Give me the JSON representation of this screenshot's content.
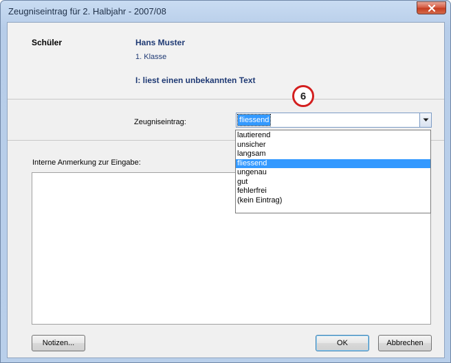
{
  "window": {
    "title": "Zeugniseintrag für 2. Halbjahr - 2007/08"
  },
  "header": {
    "student_label": "Schüler",
    "student_name": "Hans Muster",
    "student_class": "1. Klasse",
    "subject": "I: liest einen unbekannten Text"
  },
  "entry": {
    "label": "Zeugniseintrag:",
    "selected_value": "fliessend",
    "options": [
      "lautierend",
      "unsicher",
      "langsam",
      "fliessend",
      "ungenau",
      "gut",
      "fehlerfrei",
      "(kein Eintrag)"
    ],
    "selected_index": 3
  },
  "annotation": {
    "step_number": "6"
  },
  "notes": {
    "label": "Interne Anmerkung zur Eingabe:",
    "value": ""
  },
  "buttons": {
    "notes": "Notizen...",
    "ok": "OK",
    "cancel": "Abbrechen"
  },
  "colors": {
    "selection": "#3399ff",
    "header_text": "#1f3a74",
    "badge_ring": "#d31f1f"
  }
}
